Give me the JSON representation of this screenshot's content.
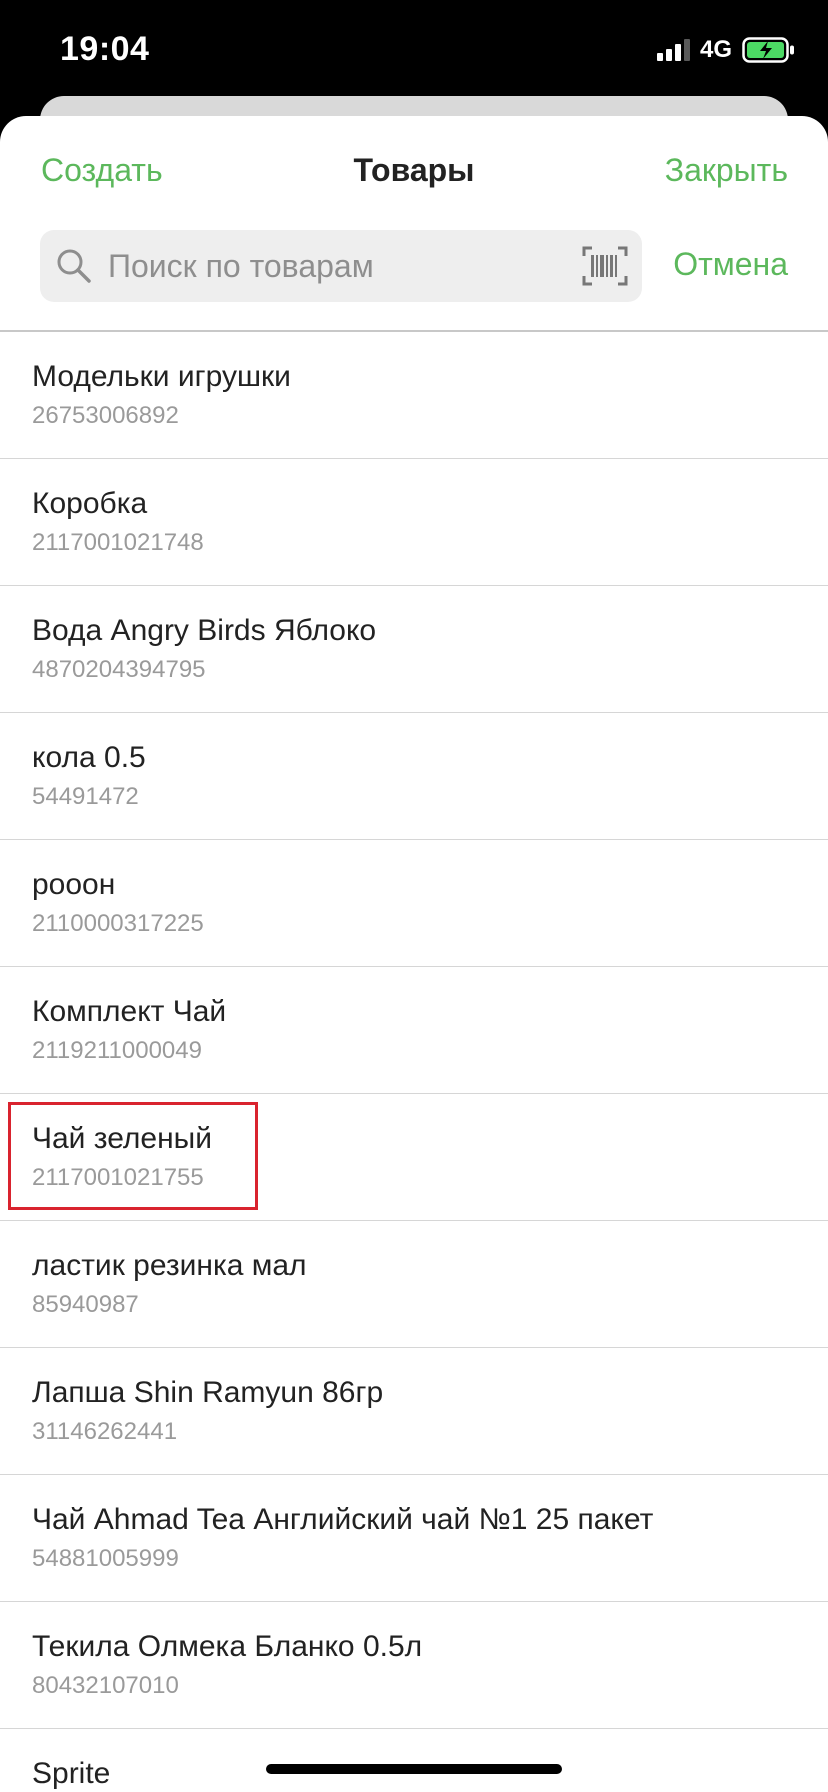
{
  "status_bar": {
    "time": "19:04",
    "network": "4G",
    "icons": [
      "signal-icon",
      "battery-charging-icon"
    ]
  },
  "nav": {
    "create_label": "Создать",
    "title": "Товары",
    "close_label": "Закрыть"
  },
  "search": {
    "placeholder": "Поиск по товарам",
    "value": "",
    "cancel_label": "Отмена",
    "icons": [
      "search-icon",
      "barcode-scan-icon"
    ]
  },
  "colors": {
    "accent": "#5cb85c",
    "highlight": "#d9232e"
  },
  "products": [
    {
      "name": "Модельки игрушки",
      "code": "26753006892"
    },
    {
      "name": "Коробка",
      "code": "2117001021748"
    },
    {
      "name": "Вода Angry Birds Яблоко",
      "code": "4870204394795"
    },
    {
      "name": "кола 0.5",
      "code": "54491472"
    },
    {
      "name": "рооон",
      "code": "2110000317225"
    },
    {
      "name": "Комплект Чай",
      "code": "2119211000049"
    },
    {
      "name": "Чай зеленый",
      "code": "2117001021755",
      "highlighted": true
    },
    {
      "name": "ластик резинка мал",
      "code": "85940987"
    },
    {
      "name": "Лапша Shin Ramyun 86гр",
      "code": "31146262441"
    },
    {
      "name": "Чай Ahmad Tea Английский чай №1 25 пакет",
      "code": "54881005999"
    },
    {
      "name": "Текила Олмека Бланко 0.5л",
      "code": "80432107010"
    },
    {
      "name": "Sprite",
      "code": ""
    }
  ]
}
